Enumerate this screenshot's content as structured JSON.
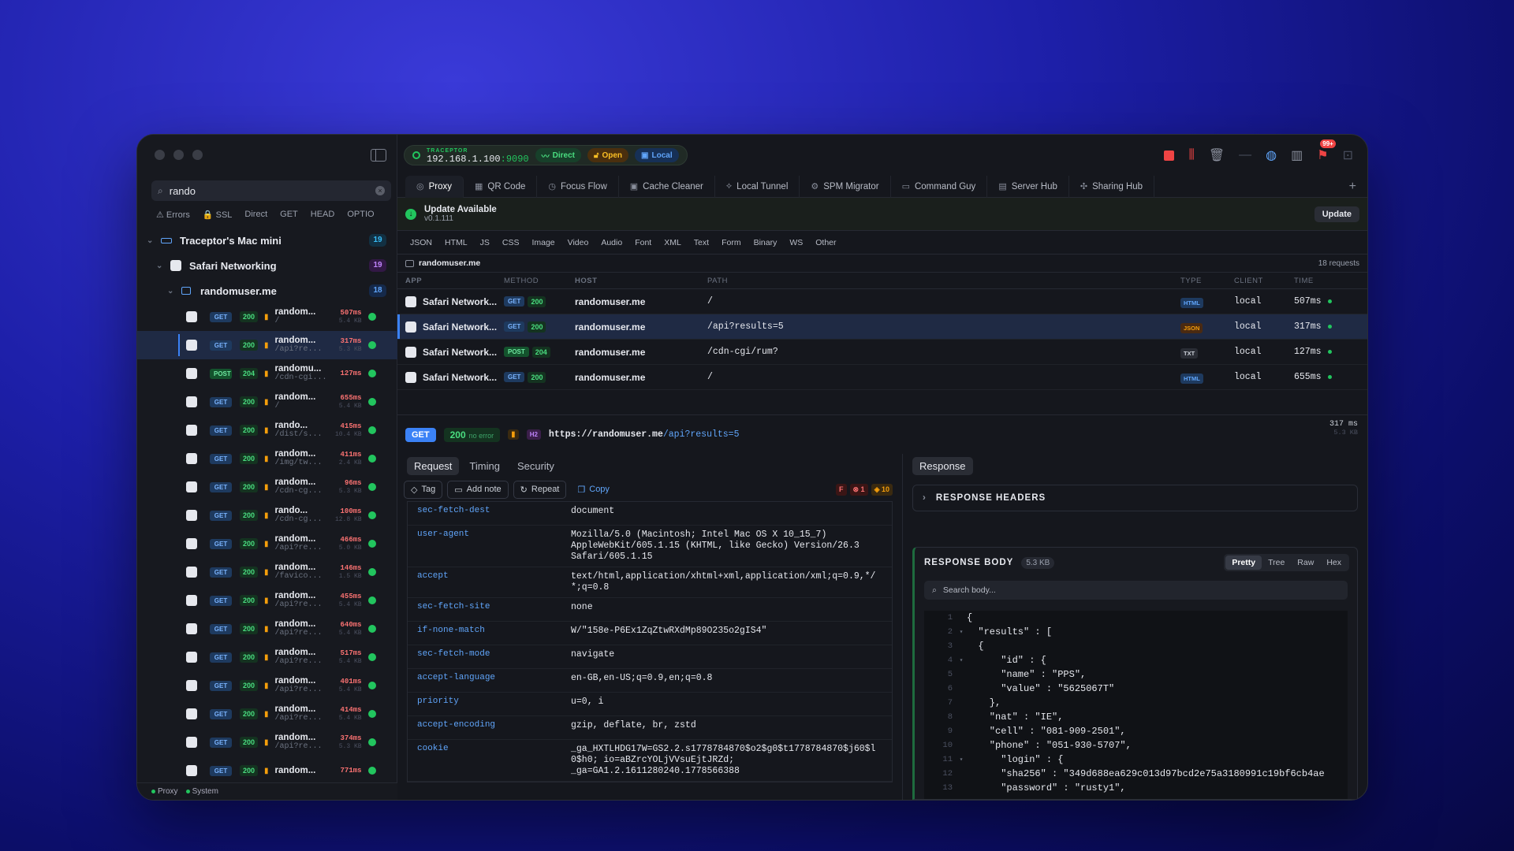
{
  "sidebar": {
    "search_value": "rando",
    "filters": [
      "⚠ Errors",
      "🔒 SSL",
      "Direct",
      "GET",
      "HEAD",
      "OPTIO"
    ],
    "tree": [
      {
        "label": "Traceptor's Mac mini",
        "count": "19",
        "count_color": "#38bdf8",
        "count_bg": "#123042"
      },
      {
        "label": "Safari Networking",
        "count": "19",
        "count_color": "#c084fc",
        "count_bg": "#321845"
      },
      {
        "label": "randomuser.me",
        "count": "18",
        "count_color": "#60a5fa",
        "count_bg": "#15294a"
      }
    ],
    "rows": [
      {
        "method": "GET",
        "status": "200",
        "name": "random...",
        "path": "/",
        "time": "507ms",
        "size": "5.4 KB"
      },
      {
        "method": "GET",
        "status": "200",
        "name": "random...",
        "path": "/api?re...",
        "time": "317ms",
        "size": "5.3 KB"
      },
      {
        "method": "POST",
        "status": "204",
        "name": "randomu...",
        "path": "/cdn-cgi...",
        "time": "127ms",
        "size": ""
      },
      {
        "method": "GET",
        "status": "200",
        "name": "random...",
        "path": "/",
        "time": "655ms",
        "size": "5.4 KB"
      },
      {
        "method": "GET",
        "status": "200",
        "name": "rando...",
        "path": "/dist/s...",
        "time": "415ms",
        "size": "10.4 KB"
      },
      {
        "method": "GET",
        "status": "200",
        "name": "random...",
        "path": "/img/tw...",
        "time": "411ms",
        "size": "2.4 KB"
      },
      {
        "method": "GET",
        "status": "200",
        "name": "random...",
        "path": "/cdn-cg...",
        "time": "96ms",
        "size": "5.3 KB"
      },
      {
        "method": "GET",
        "status": "200",
        "name": "rando...",
        "path": "/cdn-cg...",
        "time": "100ms",
        "size": "12.8 KB"
      },
      {
        "method": "GET",
        "status": "200",
        "name": "random...",
        "path": "/api?re...",
        "time": "466ms",
        "size": "5.0 KB"
      },
      {
        "method": "GET",
        "status": "200",
        "name": "random...",
        "path": "/favico...",
        "time": "146ms",
        "size": "1.5 KB"
      },
      {
        "method": "GET",
        "status": "200",
        "name": "random...",
        "path": "/api?re...",
        "time": "455ms",
        "size": "5.4 KB"
      },
      {
        "method": "GET",
        "status": "200",
        "name": "random...",
        "path": "/api?re...",
        "time": "640ms",
        "size": "5.4 KB"
      },
      {
        "method": "GET",
        "status": "200",
        "name": "random...",
        "path": "/api?re...",
        "time": "517ms",
        "size": "5.4 KB"
      },
      {
        "method": "GET",
        "status": "200",
        "name": "random...",
        "path": "/api?re...",
        "time": "401ms",
        "size": "5.4 KB"
      },
      {
        "method": "GET",
        "status": "200",
        "name": "random...",
        "path": "/api?re...",
        "time": "414ms",
        "size": "5.4 KB"
      },
      {
        "method": "GET",
        "status": "200",
        "name": "random...",
        "path": "/api?re...",
        "time": "374ms",
        "size": "5.3 KB"
      },
      {
        "method": "GET",
        "status": "200",
        "name": "random...",
        "path": "",
        "time": "771ms",
        "size": ""
      }
    ],
    "footer": [
      "Proxy",
      "System"
    ]
  },
  "topbar": {
    "brand": "TRACEPTOR",
    "ip": "192.168.1.100",
    "port": ":9090",
    "direct": "Direct",
    "open": "Open",
    "local": "Local",
    "notif": "99+"
  },
  "tabs": [
    "Proxy",
    "QR Code",
    "Focus Flow",
    "Cache Cleaner",
    "Local Tunnel",
    "SPM Migrator",
    "Command Guy",
    "Server Hub",
    "Sharing Hub"
  ],
  "tab_icons": [
    "◎",
    "▦",
    "◷",
    "▣",
    "⟡",
    "⚙",
    "▭",
    "▤",
    "✣"
  ],
  "update": {
    "title": "Update Available",
    "version": "v0.1.111",
    "button": "Update"
  },
  "types": [
    "JSON",
    "HTML",
    "JS",
    "CSS",
    "Image",
    "Video",
    "Audio",
    "Font",
    "XML",
    "Text",
    "Form",
    "Binary",
    "WS",
    "Other"
  ],
  "host_bar": {
    "host": "randomuser.me",
    "count": "18 requests"
  },
  "table": {
    "headers": [
      "APP",
      "METHOD",
      "HOST",
      "PATH",
      "TYPE",
      "CLIENT",
      "TIME"
    ],
    "rows": [
      {
        "app": "Safari Network...",
        "method": "GET",
        "status": "200",
        "host": "randomuser.me",
        "path": "/",
        "type": "HTML",
        "client": "local",
        "time": "507ms"
      },
      {
        "app": "Safari Network...",
        "method": "GET",
        "status": "200",
        "host": "randomuser.me",
        "path": "/api?results=5",
        "type": "JSON",
        "client": "local",
        "time": "317ms"
      },
      {
        "app": "Safari Network...",
        "method": "POST",
        "status": "204",
        "host": "randomuser.me",
        "path": "/cdn-cgi/rum?",
        "type": "TXT",
        "client": "local",
        "time": "127ms"
      },
      {
        "app": "Safari Network...",
        "method": "GET",
        "status": "200",
        "host": "randomuser.me",
        "path": "/",
        "type": "HTML",
        "client": "local",
        "time": "655ms"
      }
    ]
  },
  "detail": {
    "method": "GET",
    "status": "200",
    "status_text": "no error",
    "proto": "H2",
    "url_base": "https://randomuser.me",
    "url_path": "/api?results=5",
    "time": "317 ms",
    "size": "5.3 KB"
  },
  "request": {
    "tabs": [
      "Request",
      "Timing",
      "Security"
    ],
    "actions": [
      "Tag",
      "Add note",
      "Repeat",
      "Copy"
    ],
    "flags": [
      "F",
      "⊗ 1",
      "◈ 10"
    ],
    "headers": [
      {
        "k": "sec-fetch-dest",
        "v": "document"
      },
      {
        "k": "user-agent",
        "v": "Mozilla/5.0 (Macintosh; Intel Mac OS X 10_15_7)\nAppleWebKit/605.1.15 (KHTML, like Gecko) Version/26.3\nSafari/605.1.15"
      },
      {
        "k": "accept",
        "v": "text/html,application/xhtml+xml,application/xml;q=0.9,*/\n*;q=0.8"
      },
      {
        "k": "sec-fetch-site",
        "v": "none"
      },
      {
        "k": "if-none-match",
        "v": "W/\"158e-P6Ex1ZqZtwRXdMp89O235o2gIS4\""
      },
      {
        "k": "sec-fetch-mode",
        "v": "navigate"
      },
      {
        "k": "accept-language",
        "v": "en-GB,en-US;q=0.9,en;q=0.8"
      },
      {
        "k": "priority",
        "v": "u=0, i"
      },
      {
        "k": "accept-encoding",
        "v": "gzip, deflate, br, zstd"
      },
      {
        "k": "cookie",
        "v": "_ga_HXTLHDG17W=GS2.2.s1778784870$o2$g0$t1778784870$j60$l\n0$h0; io=aBZrcYOLjVVsuEjtJRZd;\n_ga=GA1.2.1611280240.1778566388"
      }
    ]
  },
  "response": {
    "tab": "Response",
    "headers_title": "RESPONSE HEADERS",
    "body_title": "RESPONSE BODY",
    "body_size": "5.3 KB",
    "views": [
      "Pretty",
      "Tree",
      "Raw",
      "Hex"
    ],
    "search_placeholder": "Search body...",
    "lines": [
      {
        "n": "1",
        "f": "",
        "t": "{"
      },
      {
        "n": "2",
        "f": "▾",
        "t": "  \"results\" : ["
      },
      {
        "n": "3",
        "f": "",
        "t": "  {"
      },
      {
        "n": "4",
        "f": "▾",
        "t": "      \"id\" : {"
      },
      {
        "n": "5",
        "f": "",
        "t": "      \"name\" : \"PPS\","
      },
      {
        "n": "6",
        "f": "",
        "t": "      \"value\" : \"5625067T\""
      },
      {
        "n": "7",
        "f": "",
        "t": "    },"
      },
      {
        "n": "8",
        "f": "",
        "t": "    \"nat\" : \"IE\","
      },
      {
        "n": "9",
        "f": "",
        "t": "    \"cell\" : \"081-909-2501\","
      },
      {
        "n": "10",
        "f": "",
        "t": "    \"phone\" : \"051-930-5707\","
      },
      {
        "n": "11",
        "f": "▾",
        "t": "      \"login\" : {"
      },
      {
        "n": "12",
        "f": "",
        "t": "      \"sha256\" : \"349d688ea629c013d97bcd2e75a3180991c19bf6cb4ae"
      },
      {
        "n": "13",
        "f": "",
        "t": "      \"password\" : \"rusty1\","
      }
    ]
  }
}
